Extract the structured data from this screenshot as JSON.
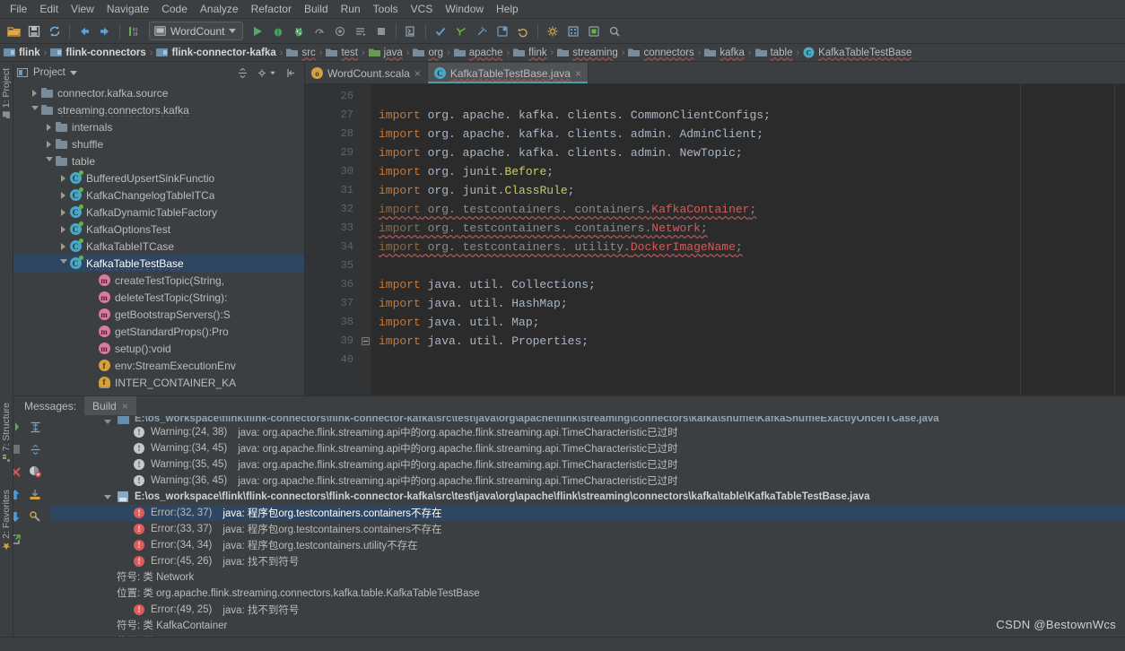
{
  "menu": {
    "items": [
      "File",
      "Edit",
      "View",
      "Navigate",
      "Code",
      "Analyze",
      "Refactor",
      "Build",
      "Run",
      "Tools",
      "VCS",
      "Window",
      "Help"
    ]
  },
  "toolbar": {
    "icons": [
      "open-folder-icon",
      "save-all-icon",
      "sync-icon",
      "back-icon",
      "forward-icon",
      "compile-icon"
    ],
    "run_config": "WordCount",
    "right_icons": [
      "run-icon",
      "debug-icon",
      "run-coverage-icon",
      "profile-icon",
      "attach-icon",
      "build-project-icon",
      "stop-icon",
      "run-anything-icon",
      "update-project-icon",
      "commit-icon",
      "diff-icon",
      "rollback-icon",
      "settings-icon",
      "project-structure-icon",
      "sdk-icon",
      "search-icon"
    ]
  },
  "breadcrumb": {
    "items": [
      {
        "label": "flink",
        "icon": "module-icon",
        "bold": true
      },
      {
        "label": "flink-connectors",
        "icon": "module-icon",
        "bold": true
      },
      {
        "label": "flink-connector-kafka",
        "icon": "module-icon",
        "bold": true
      },
      {
        "label": "src",
        "icon": "folder-icon",
        "bold": false
      },
      {
        "label": "test",
        "icon": "folder-icon",
        "bold": false
      },
      {
        "label": "java",
        "icon": "source-folder-icon",
        "bold": false
      },
      {
        "label": "org",
        "icon": "folder-icon",
        "bold": false
      },
      {
        "label": "apache",
        "icon": "folder-icon",
        "bold": false
      },
      {
        "label": "flink",
        "icon": "folder-icon",
        "bold": false
      },
      {
        "label": "streaming",
        "icon": "folder-icon",
        "bold": false
      },
      {
        "label": "connectors",
        "icon": "folder-icon",
        "bold": false
      },
      {
        "label": "kafka",
        "icon": "folder-icon",
        "bold": false
      },
      {
        "label": "table",
        "icon": "folder-icon",
        "bold": false
      },
      {
        "label": "KafkaTableTestBase",
        "icon": "class-icon",
        "bold": false
      }
    ],
    "separator": "›"
  },
  "left_strip": {
    "project_label": "1: Project",
    "structure_label": "7: Structure",
    "favorites_label": "2: Favorites"
  },
  "project_panel": {
    "title": "Project",
    "header_icons": [
      "collapse-all-icon",
      "settings-icon",
      "hide-icon"
    ],
    "tree": [
      {
        "depth": 2,
        "arrow": "closed",
        "icon": "folder-icon",
        "label": "connector.kafka.source",
        "selected": false,
        "wavy": false
      },
      {
        "depth": 2,
        "arrow": "open",
        "icon": "folder-icon",
        "label": "streaming.connectors.kafka",
        "selected": false,
        "wavy": true
      },
      {
        "depth": 3,
        "arrow": "closed",
        "icon": "folder-icon",
        "label": "internals",
        "selected": false,
        "wavy": false
      },
      {
        "depth": 3,
        "arrow": "closed",
        "icon": "folder-icon",
        "label": "shuffle",
        "selected": false,
        "wavy": false
      },
      {
        "depth": 3,
        "arrow": "open",
        "icon": "folder-icon",
        "label": "table",
        "selected": false,
        "wavy": false
      },
      {
        "depth": 4,
        "arrow": "closed",
        "icon": "class-icon",
        "label": "BufferedUpsertSinkFunctio",
        "selected": false,
        "wavy": false
      },
      {
        "depth": 4,
        "arrow": "closed",
        "icon": "class-icon",
        "label": "KafkaChangelogTableITCa",
        "selected": false,
        "wavy": false
      },
      {
        "depth": 4,
        "arrow": "closed",
        "icon": "class-icon",
        "label": "KafkaDynamicTableFactory",
        "selected": false,
        "wavy": false
      },
      {
        "depth": 4,
        "arrow": "closed",
        "icon": "class-icon",
        "label": "KafkaOptionsTest",
        "selected": false,
        "wavy": false
      },
      {
        "depth": 4,
        "arrow": "closed",
        "icon": "class-icon",
        "label": "KafkaTableITCase",
        "selected": false,
        "wavy": false
      },
      {
        "depth": 4,
        "arrow": "open",
        "icon": "class-icon",
        "label": "KafkaTableTestBase",
        "selected": true,
        "wavy": true
      },
      {
        "depth": 6,
        "arrow": "none",
        "icon": "method-icon",
        "label": "createTestTopic(String,",
        "selected": false,
        "wavy": false
      },
      {
        "depth": 6,
        "arrow": "none",
        "icon": "method-icon",
        "label": "deleteTestTopic(String):",
        "selected": false,
        "wavy": false
      },
      {
        "depth": 6,
        "arrow": "none",
        "icon": "method-icon",
        "label": "getBootstrapServers():S",
        "selected": false,
        "wavy": false
      },
      {
        "depth": 6,
        "arrow": "none",
        "icon": "method-icon",
        "label": "getStandardProps():Pro",
        "selected": false,
        "wavy": false
      },
      {
        "depth": 6,
        "arrow": "none",
        "icon": "method-icon",
        "label": "setup():void",
        "selected": false,
        "wavy": false
      },
      {
        "depth": 6,
        "arrow": "none",
        "icon": "field-icon",
        "label": "env:StreamExecutionEnv",
        "selected": false,
        "wavy": false
      },
      {
        "depth": 6,
        "arrow": "none",
        "icon": "static-field-icon",
        "label": "INTER_CONTAINER_KA",
        "selected": false,
        "wavy": false
      }
    ]
  },
  "editor": {
    "tabs": [
      {
        "label": "WordCount.scala",
        "icon": "scala-file-icon",
        "active": false,
        "closable": true,
        "wavy": false
      },
      {
        "label": "KafkaTableTestBase.java",
        "icon": "java-class-icon",
        "active": true,
        "closable": true,
        "wavy": true
      }
    ],
    "first_line_number": 26,
    "lines": [
      {
        "n": 26,
        "error": false,
        "tokens": []
      },
      {
        "n": 27,
        "error": false,
        "tokens": [
          {
            "t": "import",
            "c": "kw"
          },
          {
            "t": " org. apache. kafka. clients. CommonClientConfigs;",
            "c": "pl"
          }
        ]
      },
      {
        "n": 28,
        "error": false,
        "tokens": [
          {
            "t": "import",
            "c": "kw"
          },
          {
            "t": " org. apache. kafka. clients. admin. AdminClient;",
            "c": "pl"
          }
        ]
      },
      {
        "n": 29,
        "error": false,
        "tokens": [
          {
            "t": "import",
            "c": "kw"
          },
          {
            "t": " org. apache. kafka. clients. admin. NewTopic;",
            "c": "pl"
          }
        ]
      },
      {
        "n": 30,
        "error": false,
        "tokens": [
          {
            "t": "import",
            "c": "kw"
          },
          {
            "t": " org. junit.",
            "c": "pl"
          },
          {
            "t": "Before",
            "c": "cls-y"
          },
          {
            "t": ";",
            "c": "pl"
          }
        ]
      },
      {
        "n": 31,
        "error": false,
        "tokens": [
          {
            "t": "import",
            "c": "kw"
          },
          {
            "t": " org. junit.",
            "c": "pl"
          },
          {
            "t": "ClassRule",
            "c": "cls-y"
          },
          {
            "t": ";",
            "c": "pl"
          }
        ]
      },
      {
        "n": 32,
        "error": true,
        "tokens": [
          {
            "t": "import",
            "c": "kw"
          },
          {
            "t": " org. testcontainers. containers.",
            "c": "pl"
          },
          {
            "t": "KafkaContainer",
            "c": "cls-r"
          },
          {
            "t": ";",
            "c": "pl"
          }
        ]
      },
      {
        "n": 33,
        "error": true,
        "tokens": [
          {
            "t": "import",
            "c": "kw"
          },
          {
            "t": " org. testcontainers. containers.",
            "c": "pl"
          },
          {
            "t": "Network",
            "c": "cls-r"
          },
          {
            "t": ";",
            "c": "pl"
          }
        ]
      },
      {
        "n": 34,
        "error": true,
        "tokens": [
          {
            "t": "import",
            "c": "kw"
          },
          {
            "t": " org. testcontainers. utility.",
            "c": "pl"
          },
          {
            "t": "DockerImageName",
            "c": "cls-r"
          },
          {
            "t": ";",
            "c": "pl"
          }
        ]
      },
      {
        "n": 35,
        "error": false,
        "tokens": []
      },
      {
        "n": 36,
        "error": false,
        "tokens": [
          {
            "t": "import",
            "c": "kw"
          },
          {
            "t": " java. util. Collections;",
            "c": "pl"
          }
        ]
      },
      {
        "n": 37,
        "error": false,
        "tokens": [
          {
            "t": "import",
            "c": "kw"
          },
          {
            "t": " java. util. HashMap;",
            "c": "pl"
          }
        ]
      },
      {
        "n": 38,
        "error": false,
        "tokens": [
          {
            "t": "import",
            "c": "kw"
          },
          {
            "t": " java. util. Map;",
            "c": "pl"
          }
        ]
      },
      {
        "n": 39,
        "error": false,
        "fold": true,
        "tokens": [
          {
            "t": "import",
            "c": "kw"
          },
          {
            "t": " java. util. Properties;",
            "c": "pl"
          }
        ]
      },
      {
        "n": 40,
        "error": false,
        "tokens": []
      }
    ]
  },
  "build_panel": {
    "tabs": [
      {
        "label": "Messages:",
        "active": false,
        "closable": false
      },
      {
        "label": "Build",
        "active": true,
        "closable": true
      }
    ],
    "left_tools": [
      "rerun-icon",
      "expand-all-icon",
      "stop-icon",
      "collapse-all-icon",
      "close-icon",
      "filter-warnings-icon",
      "up-icon",
      "export-icon",
      "down-icon",
      "settings-icon",
      "open-in-editor-icon"
    ],
    "rows": [
      {
        "kind": "file-clipped",
        "icon": "module-icon",
        "arrow": "open",
        "label": "E:\\os_workspace\\flink\\flink-connectors\\flink-connector-kafka\\src\\test\\java\\org\\apache\\flink\\streaming\\connectors\\kafka\\shuffle\\KafkaShuffleExactlyOnceITCase.java"
      },
      {
        "kind": "warning",
        "icon": "warning-icon",
        "loc": "Warning:(24, 38)",
        "text": "java: org.apache.flink.streaming.api中的org.apache.flink.streaming.api.TimeCharacteristic已过时"
      },
      {
        "kind": "warning",
        "icon": "warning-icon",
        "loc": "Warning:(34, 45)",
        "text": "java: org.apache.flink.streaming.api中的org.apache.flink.streaming.api.TimeCharacteristic已过时"
      },
      {
        "kind": "warning",
        "icon": "warning-icon",
        "loc": "Warning:(35, 45)",
        "text": "java: org.apache.flink.streaming.api中的org.apache.flink.streaming.api.TimeCharacteristic已过时"
      },
      {
        "kind": "warning",
        "icon": "warning-icon",
        "loc": "Warning:(36, 45)",
        "text": "java: org.apache.flink.streaming.api中的org.apache.flink.streaming.api.TimeCharacteristic已过时"
      },
      {
        "kind": "file",
        "icon": "file-icon",
        "arrow": "open",
        "label": "E:\\os_workspace\\flink\\flink-connectors\\flink-connector-kafka\\src\\test\\java\\org\\apache\\flink\\streaming\\connectors\\kafka\\table\\KafkaTableTestBase.java"
      },
      {
        "kind": "error",
        "icon": "error-icon",
        "loc": "Error:(32, 37)",
        "text": "java: 程序包org.testcontainers.containers不存在",
        "selected": true
      },
      {
        "kind": "error",
        "icon": "error-icon",
        "loc": "Error:(33, 37)",
        "text": "java: 程序包org.testcontainers.containers不存在"
      },
      {
        "kind": "error",
        "icon": "error-icon",
        "loc": "Error:(34, 34)",
        "text": "java: 程序包org.testcontainers.utility不存在"
      },
      {
        "kind": "error",
        "icon": "error-icon",
        "loc": "Error:(45, 26)",
        "text": "java: 找不到符号"
      },
      {
        "kind": "sub",
        "text": "符号:   类 Network"
      },
      {
        "kind": "sub",
        "text": "位置: 类 org.apache.flink.streaming.connectors.kafka.table.KafkaTableTestBase"
      },
      {
        "kind": "error",
        "icon": "error-icon",
        "loc": "Error:(49, 25)",
        "text": "java: 找不到符号"
      },
      {
        "kind": "sub",
        "text": "符号:   类 KafkaContainer"
      },
      {
        "kind": "sub",
        "text": "位置: 类 org.apache.flink.streaming.connectors.kafka.table.KafkaTableTestBase"
      }
    ]
  },
  "watermark": "CSDN @BestownWcs",
  "colors": {
    "background": "#3c3f41",
    "editor_background": "#2b2b2b",
    "selection": "#2f4661",
    "keyword": "#cc7832",
    "plain_text": "#a9b7c6",
    "class_yellow": "#c9c96a",
    "class_error_red": "#d45b5b",
    "error_icon": "#e05c5c",
    "accent_green": "#62b543"
  }
}
